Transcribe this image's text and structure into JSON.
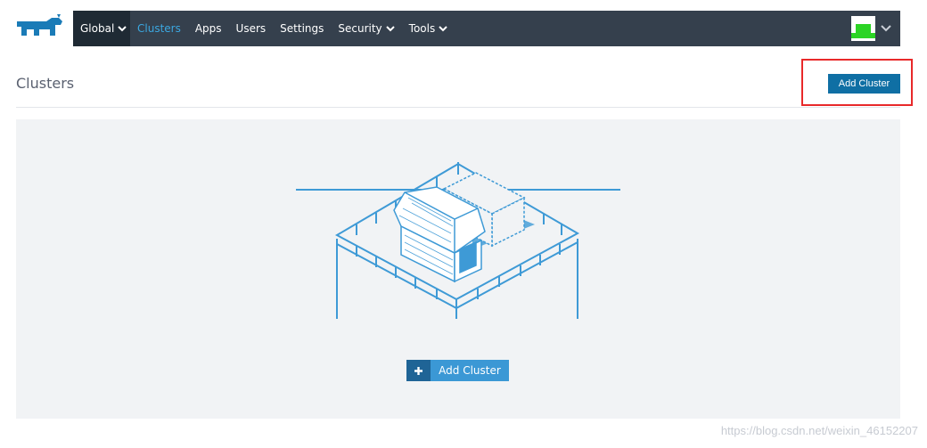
{
  "nav": {
    "global_label": "Global",
    "items": [
      {
        "label": "Clusters"
      },
      {
        "label": "Apps"
      },
      {
        "label": "Users"
      },
      {
        "label": "Settings"
      },
      {
        "label": "Security"
      },
      {
        "label": "Tools"
      }
    ]
  },
  "page": {
    "title": "Clusters",
    "add_cluster_label": "Add Cluster"
  },
  "empty_state": {
    "add_cluster_label": "Add Cluster",
    "illustration": "barn-farm-icon"
  },
  "watermark": "https://blog.csdn.net/weixin_46152207",
  "colors": {
    "nav_bg": "#35404d",
    "nav_global_bg": "#1f2a34",
    "nav_active": "#3ba7e0",
    "primary_button": "#0f6fa4",
    "empty_button": "#3b98d5",
    "highlight": "#e8292a",
    "illustration": "#3e9ad6"
  }
}
